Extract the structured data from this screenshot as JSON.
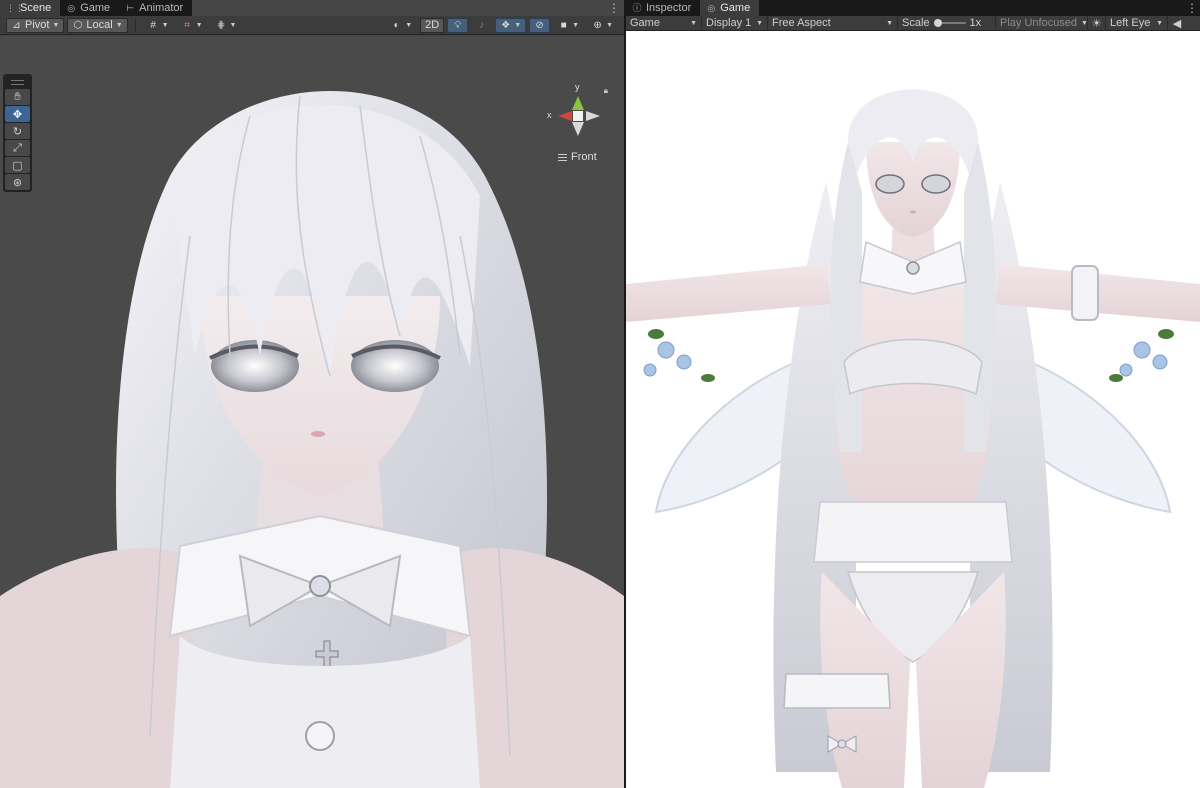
{
  "scene_panel": {
    "tabs": [
      {
        "label": "Scene",
        "icon": "grid-icon",
        "active": true
      },
      {
        "label": "Game",
        "icon": "gamepad-icon",
        "active": false
      },
      {
        "label": "Animator",
        "icon": "animator-icon",
        "active": false
      }
    ],
    "toolbar": {
      "pivot_label": "Pivot",
      "local_label": "Local",
      "mode_2d_label": "2D"
    },
    "tools": [
      "hand-tool",
      "move-tool",
      "rotate-tool",
      "scale-tool",
      "rect-tool",
      "transform-tool"
    ],
    "gizmo": {
      "axis_y": "y",
      "axis_x": "x",
      "view_label": "Front"
    }
  },
  "game_panel": {
    "tabs": [
      {
        "label": "Inspector",
        "icon": "info-icon",
        "active": false
      },
      {
        "label": "Game",
        "icon": "gamepad-icon",
        "active": true
      }
    ],
    "toolbar": {
      "mode": "Game",
      "display": "Display 1",
      "aspect": "Free Aspect",
      "scale_label": "Scale",
      "scale_value": "1x",
      "play_mode": "Play Unfocused",
      "eye": "Left Eye"
    }
  },
  "colors": {
    "editor_bg": "#191919",
    "toolbar_bg": "#3c3c3c",
    "scene_bg": "#4a4a4a",
    "active_blue": "#46607c",
    "game_bg": "#ffffff",
    "axis_x": "#d2473c",
    "axis_y": "#8ac33e"
  }
}
